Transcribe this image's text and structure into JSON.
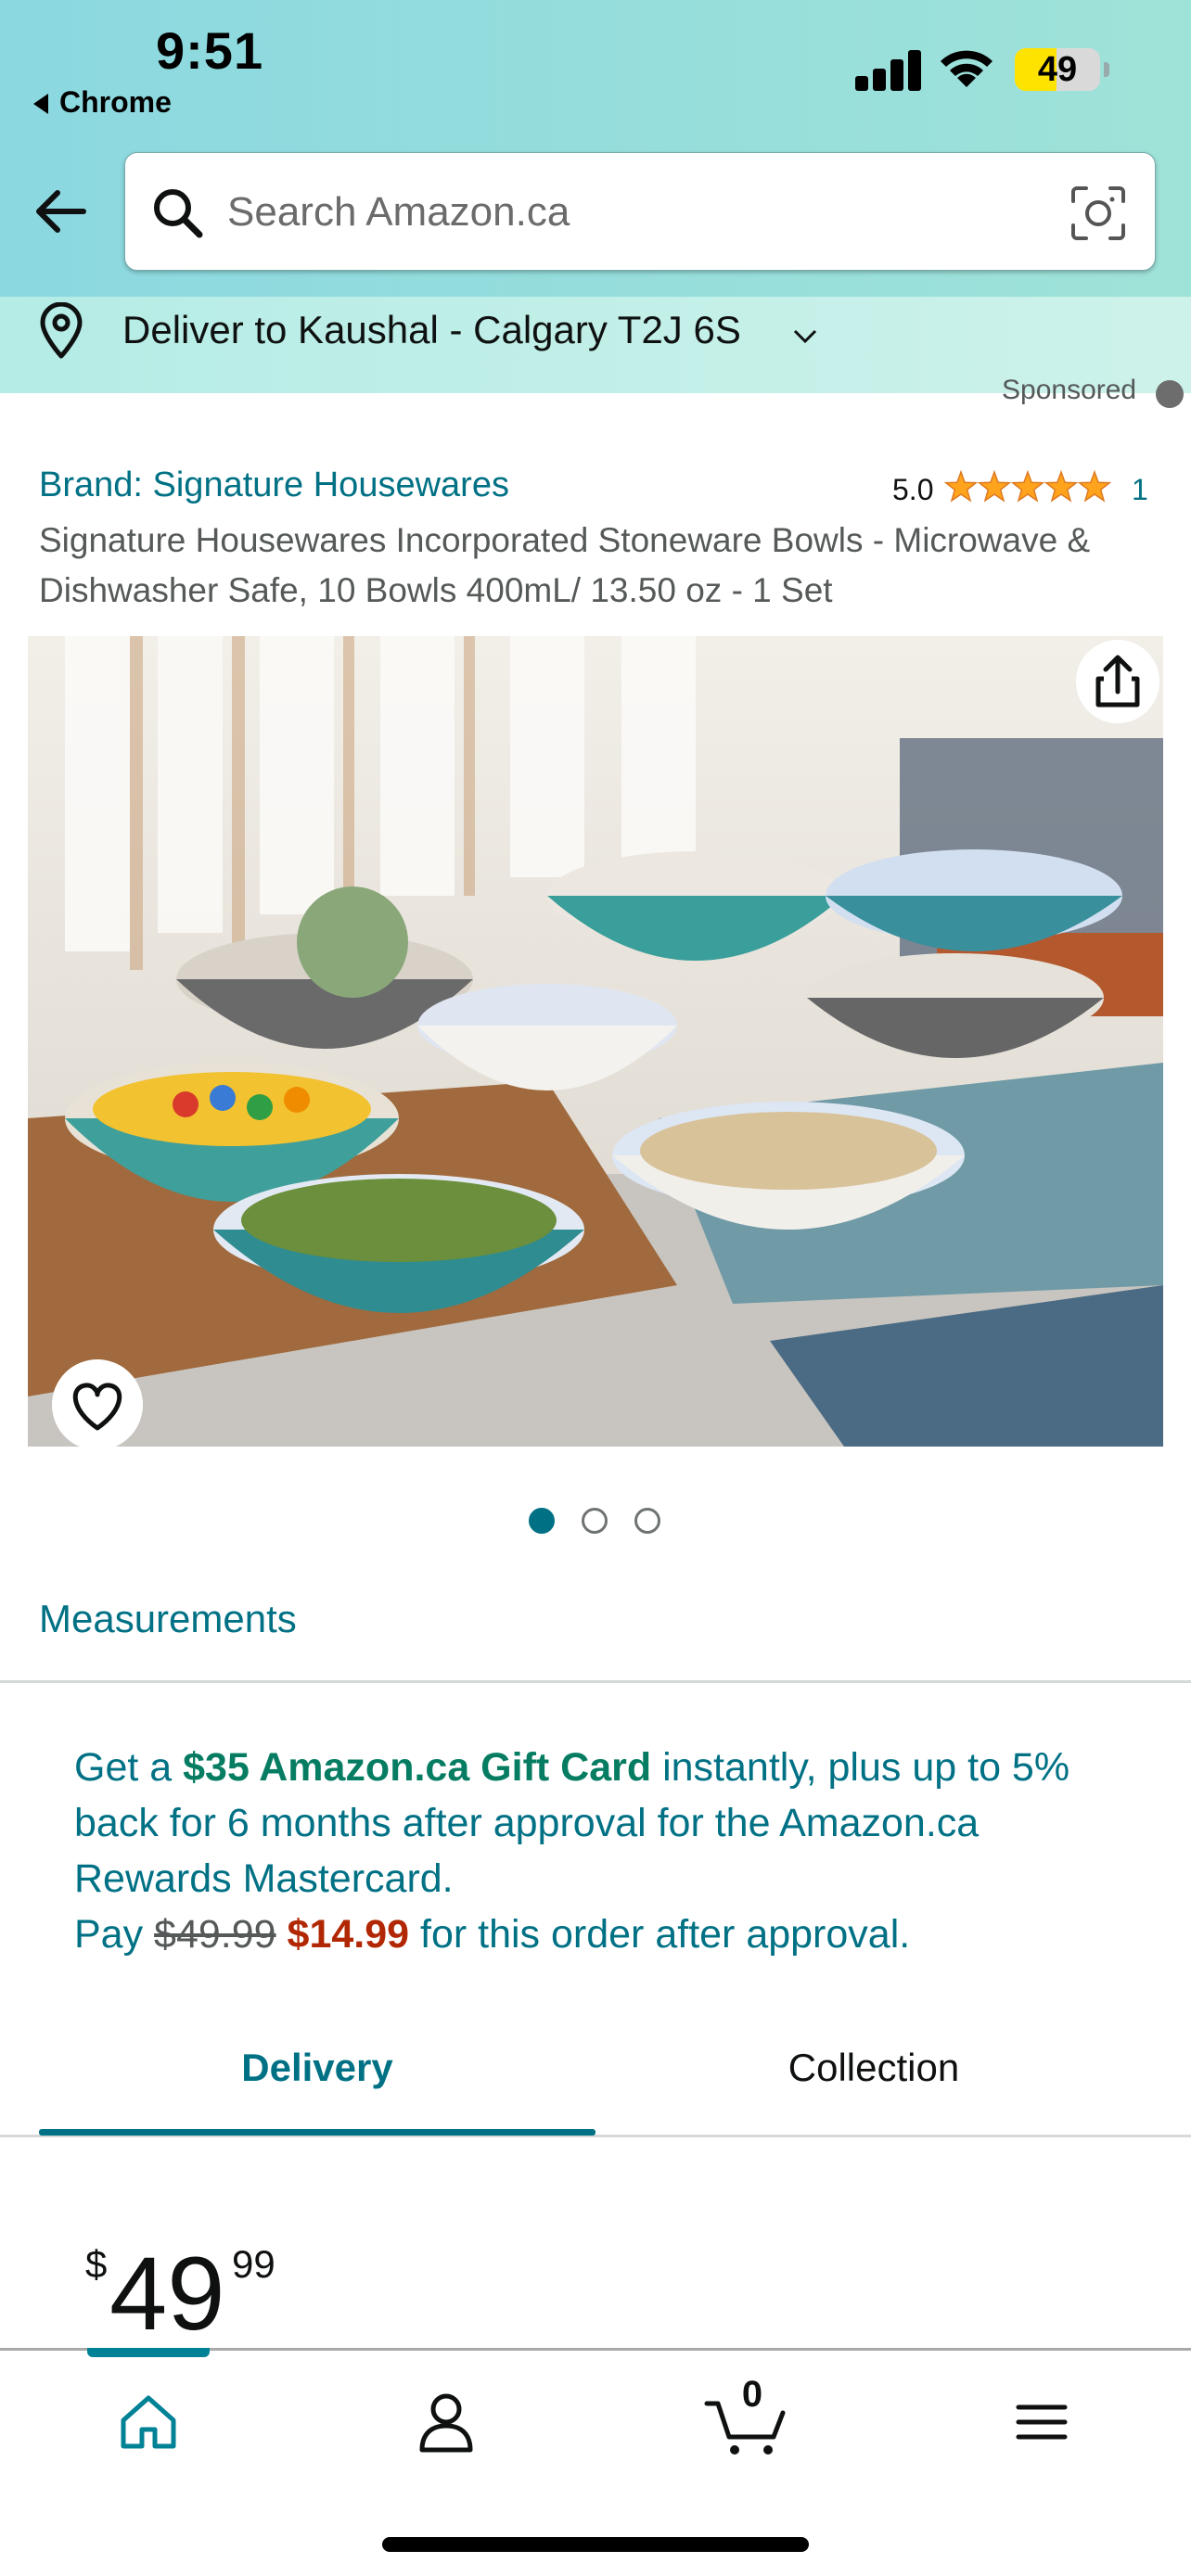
{
  "status_bar": {
    "time": "9:51",
    "back_app": "Chrome",
    "battery": "49",
    "battery_level": 0.49
  },
  "header": {
    "search_placeholder": "Search Amazon.ca",
    "deliver_to": "Deliver to Kaushal - Calgary T2J 6S",
    "colors": {
      "header_bg": "#8bd8e0",
      "deliver_bg": "#b5ece6"
    }
  },
  "product": {
    "sponsored_label": "Sponsored",
    "brand": "Brand: Signature Housewares",
    "rating": "5.0",
    "rating_stars": 5,
    "rating_count": "1",
    "title": "Signature Housewares Incorporated Stoneware Bowls - Microwave & Dishwasher Safe, 10 Bowls 400mL/ 13.50 oz - 1 Set",
    "image_count": 3,
    "image_active_index": 0,
    "measurements_link": "Measurements"
  },
  "promo": {
    "prefix": "Get a ",
    "gift_card": "$35 Amazon.ca Gift Card",
    "mid": " instantly, plus up to 5% back for 6 months after approval for the Amazon.ca Rewards Mastercard.",
    "pay_prefix": "Pay ",
    "old_price": "$49.99",
    "new_price": "$14.99",
    "pay_suffix": " for this order after approval.",
    "colors": {
      "link": "#007185",
      "green": "#067d62",
      "red": "#b12704"
    }
  },
  "tabs": [
    {
      "label": "Delivery",
      "active": true
    },
    {
      "label": "Collection",
      "active": false
    }
  ],
  "price": {
    "symbol": "$",
    "whole": "49",
    "fraction": "99"
  },
  "bottom_nav": {
    "items": [
      "home-icon",
      "account-icon",
      "cart-icon",
      "menu-icon"
    ],
    "cart_count": "0",
    "active": "home"
  }
}
